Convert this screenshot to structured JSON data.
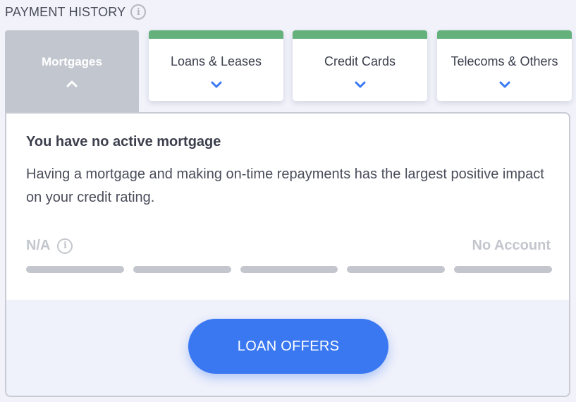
{
  "header": {
    "title": "PAYMENT HISTORY",
    "info_icon": "info-icon"
  },
  "tabs": [
    {
      "label": "Mortgages",
      "active": true,
      "icon": "chevron-up-icon"
    },
    {
      "label": "Loans & Leases",
      "active": false,
      "icon": "chevron-down-icon"
    },
    {
      "label": "Credit Cards",
      "active": false,
      "icon": "chevron-down-icon"
    },
    {
      "label": "Telecoms & Others",
      "active": false,
      "icon": "chevron-down-icon"
    }
  ],
  "panel": {
    "title": "You have no active mortgage",
    "description": "Having a mortgage and making on-time repayments has the largest positive impact on your credit rating.",
    "rating_label": "N/A",
    "account_status": "No Account",
    "segment_count": 5,
    "cta_label": "LOAN OFFERS"
  },
  "colors": {
    "accent": "#3a78f2",
    "tab_bar": "#64b17c",
    "active_tab": "#c2c6cf",
    "chevron": "#3a78f2",
    "muted": "#c3c6cd"
  }
}
